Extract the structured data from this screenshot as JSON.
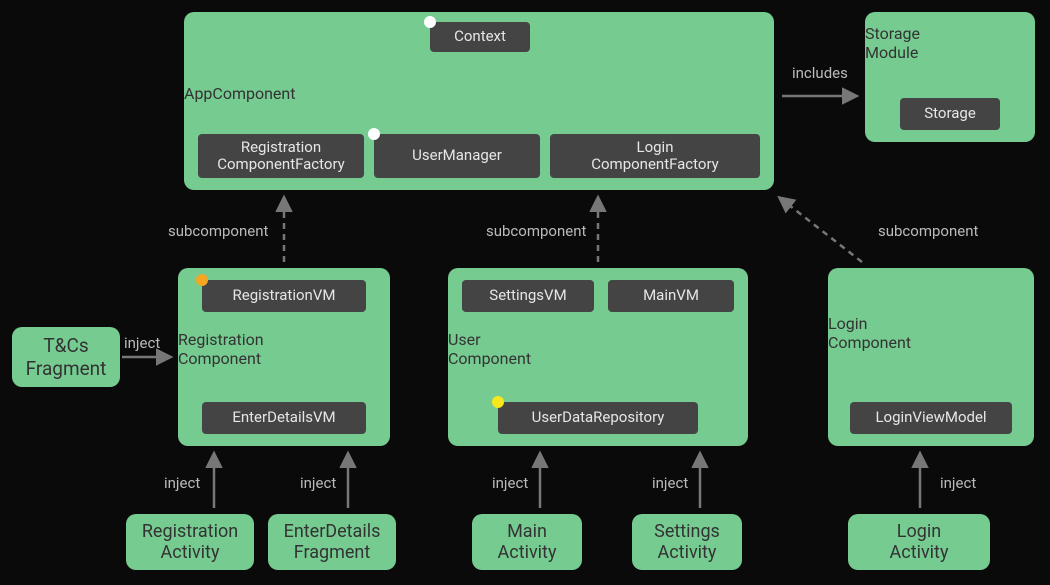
{
  "appComponent": {
    "title": "AppComponent",
    "context": "Context",
    "regFactory": "Registration\nComponentFactory",
    "userManager": "UserManager",
    "loginFactory": "Login\nComponentFactory"
  },
  "storageModule": {
    "title": "Storage\nModule",
    "storage": "Storage"
  },
  "registrationComponent": {
    "title": "Registration\nComponent",
    "registrationVM": "RegistrationVM",
    "enterDetailsVM": "EnterDetailsVM"
  },
  "userComponent": {
    "title": "User\nComponent",
    "settingsVM": "SettingsVM",
    "mainVM": "MainVM",
    "userDataRepo": "UserDataRepository"
  },
  "loginComponent": {
    "title": "Login\nComponent",
    "loginVM": "LoginViewModel"
  },
  "tcsFragment": "T&Cs\nFragment",
  "activities": {
    "registration": "Registration\nActivity",
    "enterDetails": "EnterDetails\nFragment",
    "main": "Main\nActivity",
    "settings": "Settings\nActivity",
    "login": "Login\nActivity"
  },
  "labels": {
    "includes": "includes",
    "subcomponent": "subcomponent",
    "inject": "inject"
  }
}
